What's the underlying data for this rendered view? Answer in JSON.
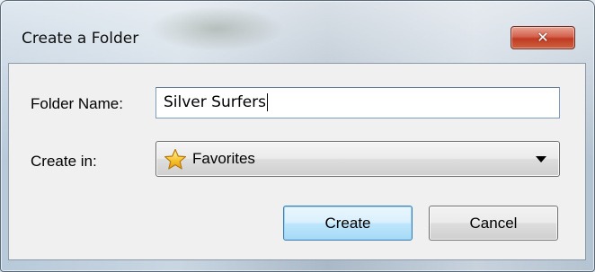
{
  "dialog": {
    "title": "Create a Folder",
    "close_icon": "close-icon"
  },
  "form": {
    "folder_name_label": "Folder Name:",
    "folder_name_value": "Silver Surfers",
    "create_in_label": "Create in:",
    "create_in_value": "Favorites",
    "create_in_icon": "star-icon"
  },
  "buttons": {
    "create_label": "Create",
    "cancel_label": "Cancel"
  },
  "colors": {
    "close_button": "#c7452c",
    "default_button_border": "#3c7fb1",
    "client_background": "#f0f0f0"
  }
}
